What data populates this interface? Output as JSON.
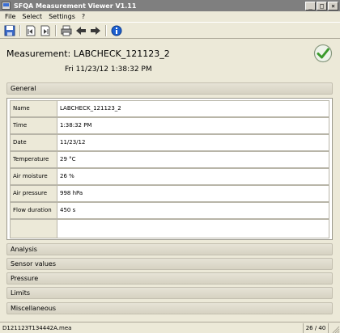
{
  "window": {
    "title": "SFQA Measurement Viewer V1.11",
    "minimize_label": "_",
    "maximize_label": "□",
    "close_label": "×"
  },
  "menu": {
    "items": [
      "File",
      "Select",
      "Settings",
      "?"
    ]
  },
  "toolbar": {
    "icons": [
      "save-icon",
      "page-first-icon",
      "page-last-icon",
      "print-icon",
      "arrow-left-icon",
      "arrow-right-icon",
      "info-icon"
    ],
    "colors": {
      "info": "#1c5fd0",
      "arrows": "#3a3a3a"
    }
  },
  "measurement": {
    "title": "Measurement: LABCHECK_121123_2",
    "datetime": "Fri  11/23/12  1:38:32 PM",
    "status_icon": "check-circle-icon",
    "status_color": "#3a9a2c"
  },
  "sections": {
    "general": "General",
    "analysis": "Analysis",
    "sensor_values": "Sensor values",
    "pressure": "Pressure",
    "limits": "Limits",
    "miscellaneous": "Miscellaneous"
  },
  "general_rows": [
    {
      "label": "Name",
      "value": "LABCHECK_121123_2"
    },
    {
      "label": "Time",
      "value": "1:38:32 PM"
    },
    {
      "label": "Date",
      "value": "11/23/12"
    },
    {
      "label": "Temperature",
      "value": "29 °C"
    },
    {
      "label": "Air moisture",
      "value": "26 %"
    },
    {
      "label": "Air pressure",
      "value": "998 hPa"
    },
    {
      "label": "Flow duration",
      "value": "450 s"
    }
  ],
  "status": {
    "file": "D121123T134442A.mea",
    "count": "26 / 40"
  }
}
